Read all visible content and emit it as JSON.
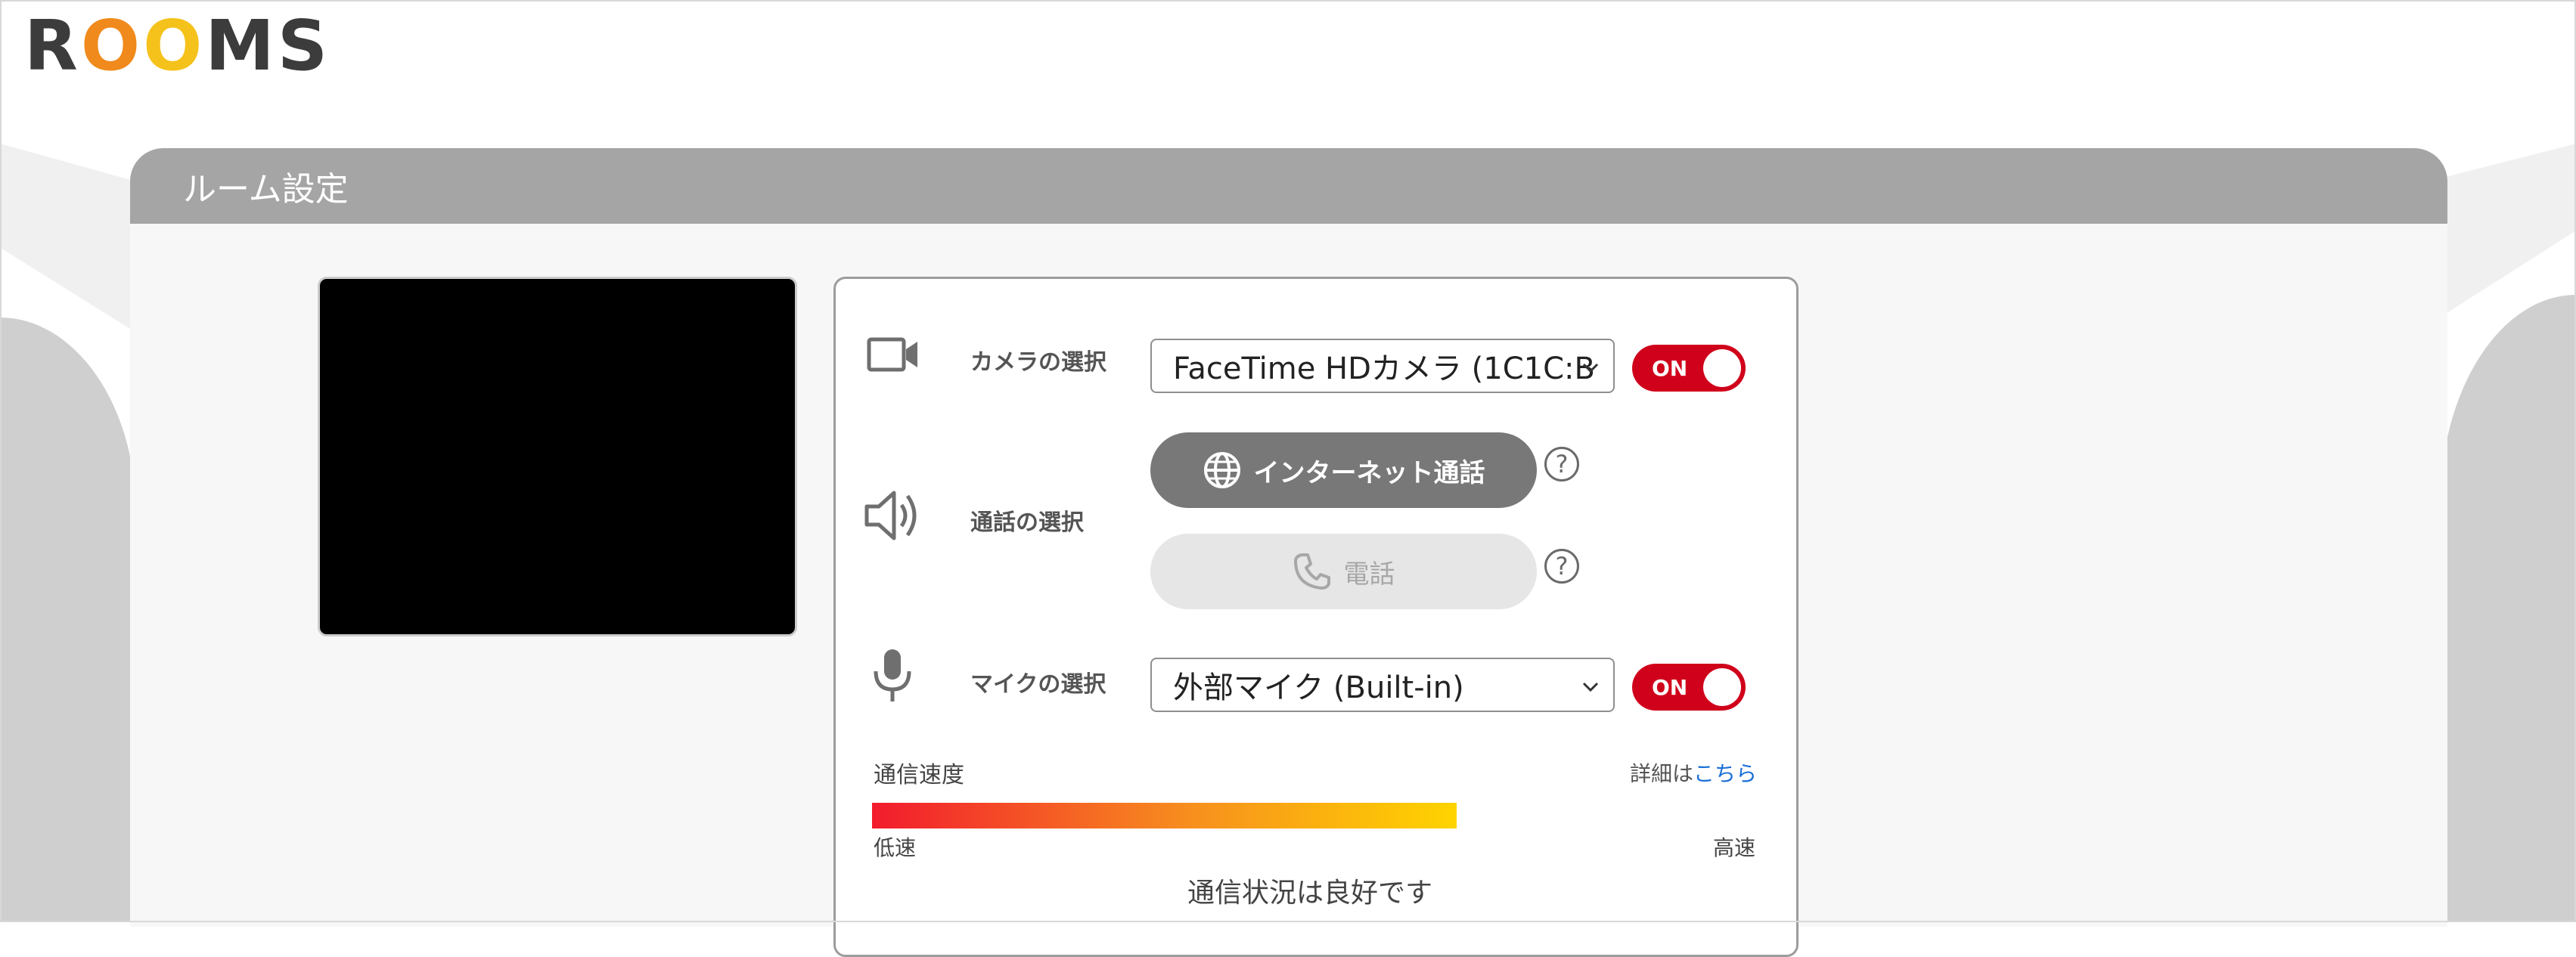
{
  "logo": {
    "part1": "R",
    "part2": "O",
    "part3": "O",
    "part4": "MS"
  },
  "panel": {
    "title": "ルーム設定"
  },
  "camera": {
    "label": "カメラの選択",
    "selected": "FaceTime HDカメラ (1C1C:B",
    "toggle": "ON"
  },
  "call": {
    "label": "通話の選択",
    "internet_button": "インターネット通話",
    "phone_button": "電話",
    "help": "?"
  },
  "mic": {
    "label": "マイクの選択",
    "selected": "外部マイク (Built-in)",
    "toggle": "ON"
  },
  "speed": {
    "label": "通信速度",
    "detail_prefix": "詳細は",
    "detail_link": "こちら",
    "low": "低速",
    "high": "高速",
    "status": "通信状況は良好です"
  },
  "colors": {
    "toggle_on": "#d0021b",
    "link": "#1a6fd6",
    "bar_start": "#f21b2d",
    "bar_end": "#ffd400"
  }
}
